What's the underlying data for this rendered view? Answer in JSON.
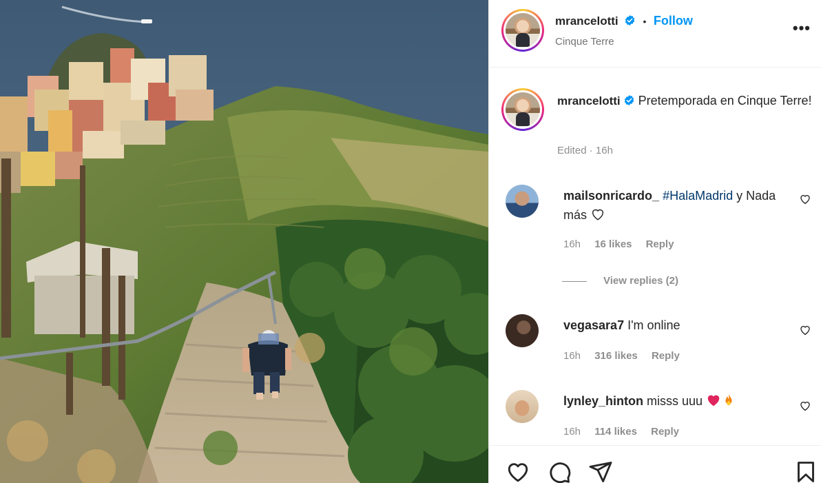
{
  "post": {
    "username": "mrancelotti",
    "follow_label": "Follow",
    "separator": "•",
    "location": "Cinque Terre",
    "more_label": "•••",
    "caption": "Pretemporada en Cinque Terre!",
    "edited_label": "Edited",
    "caption_time": "16h"
  },
  "comments": [
    {
      "username": "mailsonricardo_",
      "hashtag": "#HalaMadrid",
      "text_after_hashtag": " y Nada más",
      "time": "16h",
      "likes": "16 likes",
      "reply_label": "Reply",
      "view_replies": "View replies (2)"
    },
    {
      "username": "vegasara7",
      "text": "I'm online",
      "time": "16h",
      "likes": "316 likes",
      "reply_label": "Reply"
    },
    {
      "username": "lynley_hinton",
      "text": "misss uuu",
      "time": "16h",
      "likes": "114 likes",
      "reply_label": "Reply"
    }
  ],
  "icons": {
    "verified": "verified-badge-icon",
    "like": "heart-icon",
    "comment": "comment-icon",
    "share": "share-icon",
    "save": "bookmark-icon"
  },
  "colors": {
    "link_blue": "#0095f6",
    "hashtag": "#00376b",
    "meta_gray": "#8e8e8e",
    "heart_red": "#e0245e"
  }
}
